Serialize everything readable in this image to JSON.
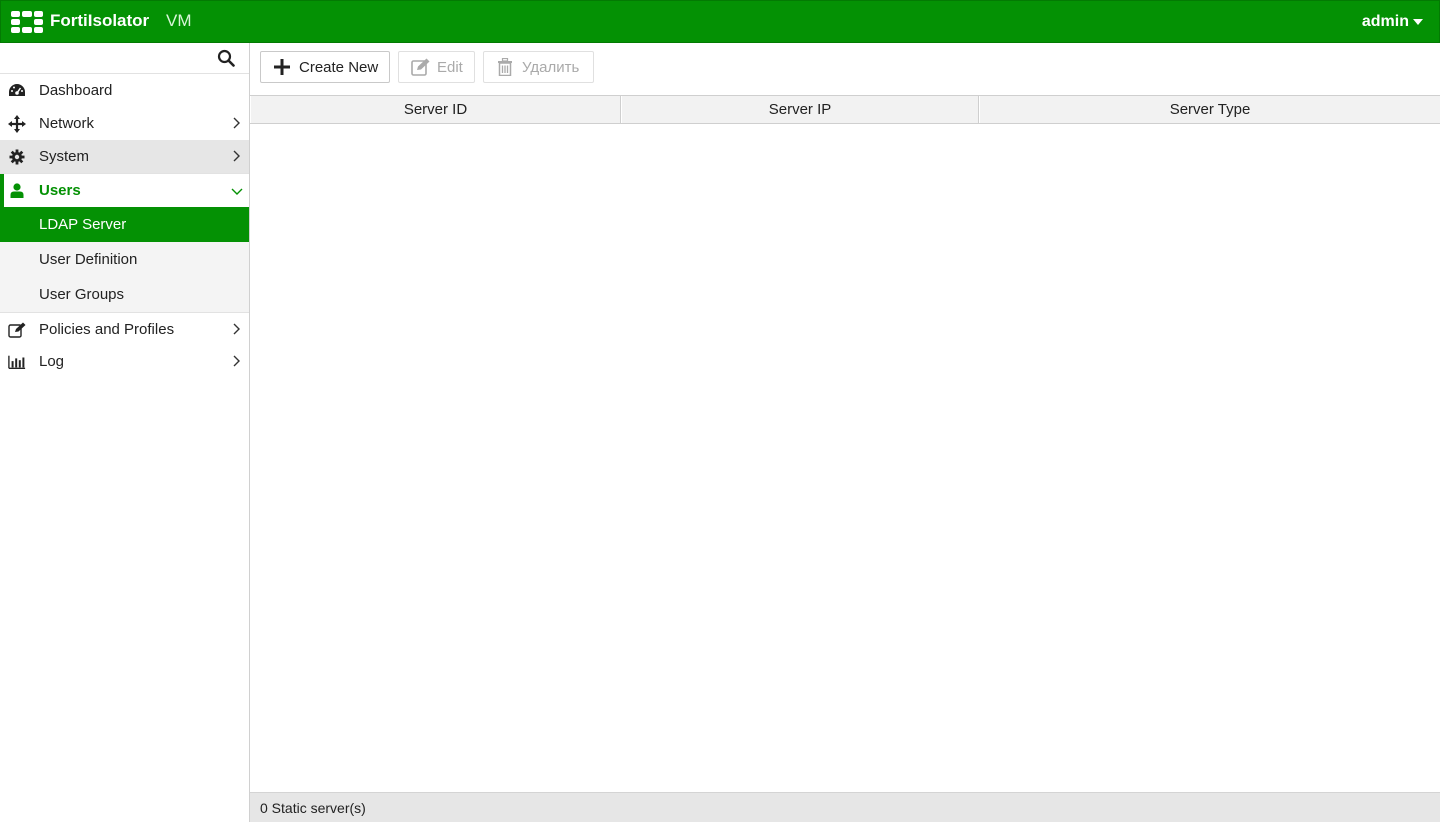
{
  "header": {
    "brand": "FortiIsolator",
    "edition": "VM",
    "user": "admin",
    "color": "#049104"
  },
  "sidebar": {
    "search_icon": "search-icon",
    "items": [
      {
        "label": "Dashboard",
        "icon": "dashboard-icon"
      },
      {
        "label": "Network",
        "icon": "network-icon"
      },
      {
        "label": "System",
        "icon": "gear-icon"
      },
      {
        "label": "Users",
        "icon": "user-icon",
        "expanded": true,
        "children": [
          {
            "label": "LDAP Server",
            "active": true
          },
          {
            "label": "User Definition"
          },
          {
            "label": "User Groups"
          }
        ]
      },
      {
        "label": "Policies and Profiles",
        "icon": "edit-icon"
      },
      {
        "label": "Log",
        "icon": "bar-chart-icon"
      }
    ]
  },
  "toolbar": {
    "create_label": "Create New",
    "edit_label": "Edit",
    "delete_label": "Удалить"
  },
  "table": {
    "columns": [
      "Server ID",
      "Server IP",
      "Server Type"
    ],
    "rows": []
  },
  "footer": {
    "status": "0 Static server(s)"
  }
}
